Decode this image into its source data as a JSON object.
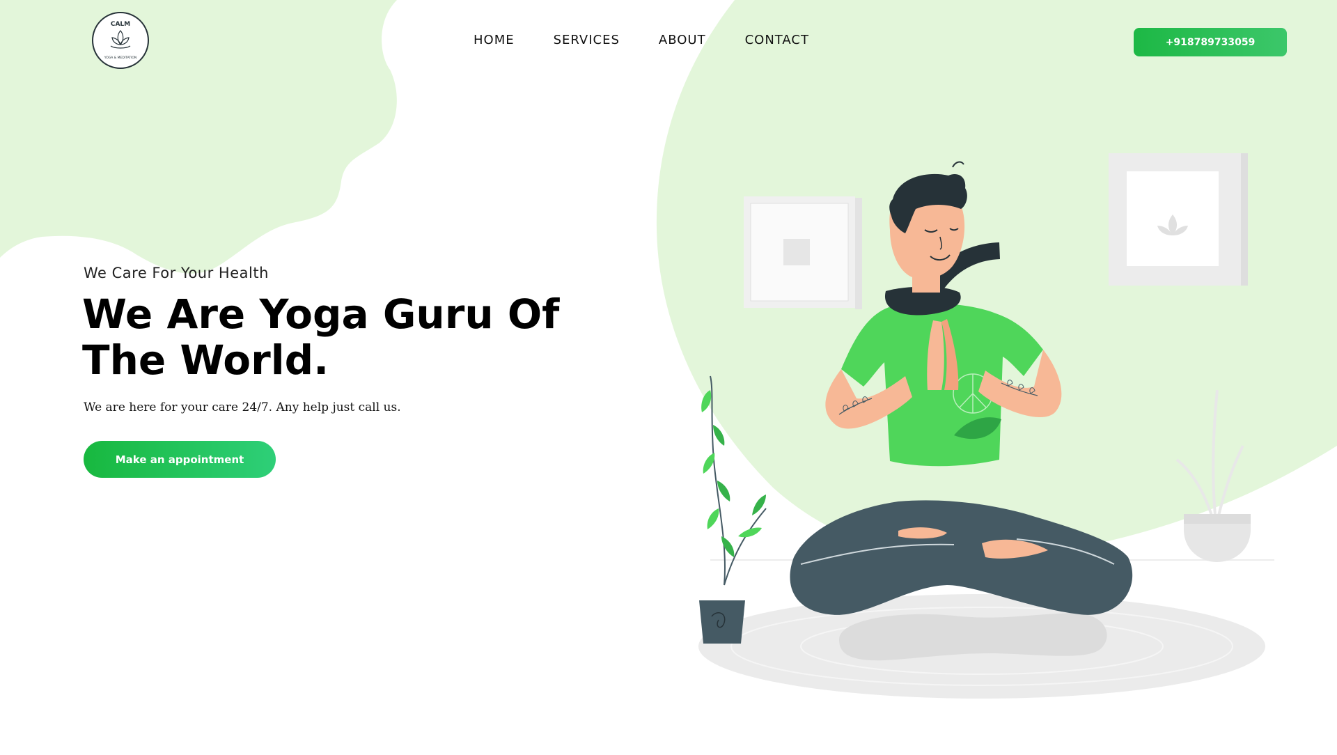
{
  "brand": {
    "logo_text": "CALM",
    "logo_subtext": "YOGA & MEDITATION"
  },
  "nav": {
    "items": [
      {
        "label": "HOME"
      },
      {
        "label": "SERVICES"
      },
      {
        "label": "ABOUT"
      },
      {
        "label": "CONTACT"
      }
    ]
  },
  "header": {
    "phone_label": "+918789733059"
  },
  "hero": {
    "subtitle": "We Care For Your Health",
    "title": "We Are Yoga Guru Of The World.",
    "description": "We are here for your care 24/7. Any help just call us.",
    "cta_label": "Make an appointment"
  },
  "colors": {
    "accent": "#1db845",
    "blob": "#e3f6da",
    "shirt": "#4fd65a",
    "pants": "#455a64",
    "skin": "#f7b896",
    "hair": "#263238"
  },
  "icons": {
    "logo": "lotus-logo-icon",
    "illustration": "meditating-man-illustration"
  }
}
